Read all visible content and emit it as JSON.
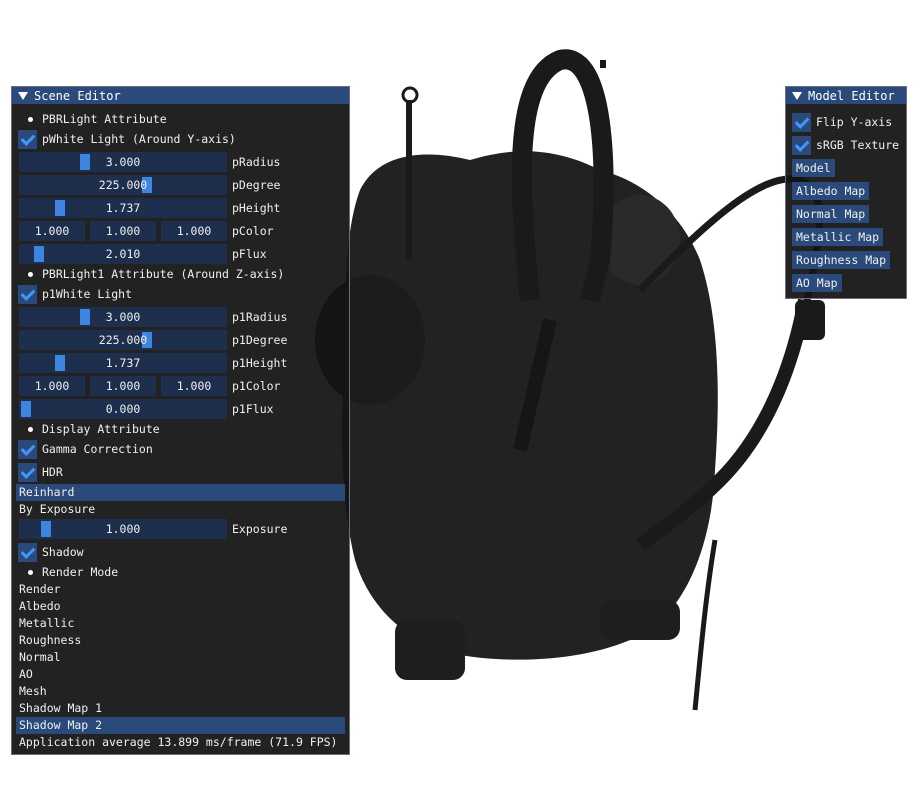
{
  "scene_editor": {
    "title": "Scene Editor",
    "pbr_light_header": "PBRLight Attribute",
    "white_light_label": "pWhite Light (Around Y-axis)",
    "p_radius": {
      "value": "3.000",
      "label": "pRadius",
      "fraction": 0.31
    },
    "p_degree": {
      "value": "225.000",
      "label": "pDegree",
      "fraction": 0.625
    },
    "p_height": {
      "value": "1.737",
      "label": "pHeight",
      "fraction": 0.17
    },
    "p_color": {
      "r": "1.000",
      "g": "1.000",
      "b": "1.000",
      "label": "pColor"
    },
    "p_flux": {
      "value": "2.010",
      "label": "pFlux",
      "fraction": 0.07
    },
    "pbr_light1_header": "PBRLight1 Attribute (Around Z-axis)",
    "white_light1_label": "p1White Light",
    "p1_radius": {
      "value": "3.000",
      "label": "p1Radius",
      "fraction": 0.31
    },
    "p1_degree": {
      "value": "225.000",
      "label": "p1Degree",
      "fraction": 0.625
    },
    "p1_height": {
      "value": "1.737",
      "label": "p1Height",
      "fraction": 0.17
    },
    "p1_color": {
      "r": "1.000",
      "g": "1.000",
      "b": "1.000",
      "label": "p1Color"
    },
    "p1_flux": {
      "value": "0.000",
      "label": "p1Flux",
      "fraction": 0.0
    },
    "display_header": "Display Attribute",
    "gamma_label": "Gamma Correction",
    "hdr_label": "HDR",
    "tonemap_options": [
      "Reinhard",
      "By Exposure"
    ],
    "tonemap_selected": "Reinhard",
    "exposure": {
      "value": "1.000",
      "label": "Exposure",
      "fraction": 0.09
    },
    "shadow_label": "Shadow",
    "render_mode_header": "Render Mode",
    "render_modes": [
      "Render",
      "Albedo",
      "Metallic",
      "Roughness",
      "Normal",
      "AO",
      "Mesh",
      "Shadow Map 1",
      "Shadow Map 2"
    ],
    "render_mode_selected": "Shadow Map 2",
    "status": "Application average 13.899 ms/frame (71.9 FPS)"
  },
  "model_editor": {
    "title": "Model Editor",
    "flip_y_label": "Flip Y-axis",
    "srgb_label": "sRGB Texture",
    "buttons": [
      "Model",
      "Albedo Map",
      "Normal Map",
      "Metallic Map",
      "Roughness Map",
      "AO Map"
    ]
  },
  "colors": {
    "title_bar": "#294a7a",
    "frame": "#1d2f4d",
    "accent": "#3d85e0"
  }
}
